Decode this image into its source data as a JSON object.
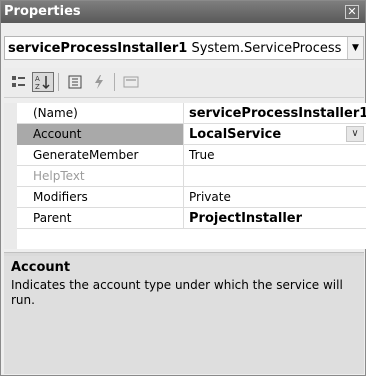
{
  "window": {
    "title": "Properties"
  },
  "selector": {
    "object_name": "serviceProcessInstaller1",
    "object_type": "System.ServiceProcess"
  },
  "toolbar": {
    "buttons": [
      {
        "icon": "categorized-icon",
        "active": false
      },
      {
        "icon": "alphabetical-icon",
        "active": true
      },
      {
        "icon": "properties-icon",
        "active": false
      },
      {
        "icon": "events-icon",
        "active": false
      },
      {
        "icon": "property-pages-icon",
        "active": false
      }
    ]
  },
  "grid": {
    "rows": [
      {
        "name": "(Name)",
        "value": "serviceProcessInstaller1",
        "bold": true
      },
      {
        "name": "Account",
        "value": "LocalService",
        "bold": true,
        "selected": true,
        "dropdown": true
      },
      {
        "name": "GenerateMember",
        "value": "True"
      },
      {
        "name": "HelpText",
        "value": "",
        "disabled": true
      },
      {
        "name": "Modifiers",
        "value": "Private"
      },
      {
        "name": "Parent",
        "value": "ProjectInstaller",
        "bold": true
      }
    ]
  },
  "description": {
    "title": "Account",
    "text": "Indicates the account type under which the service will run."
  }
}
